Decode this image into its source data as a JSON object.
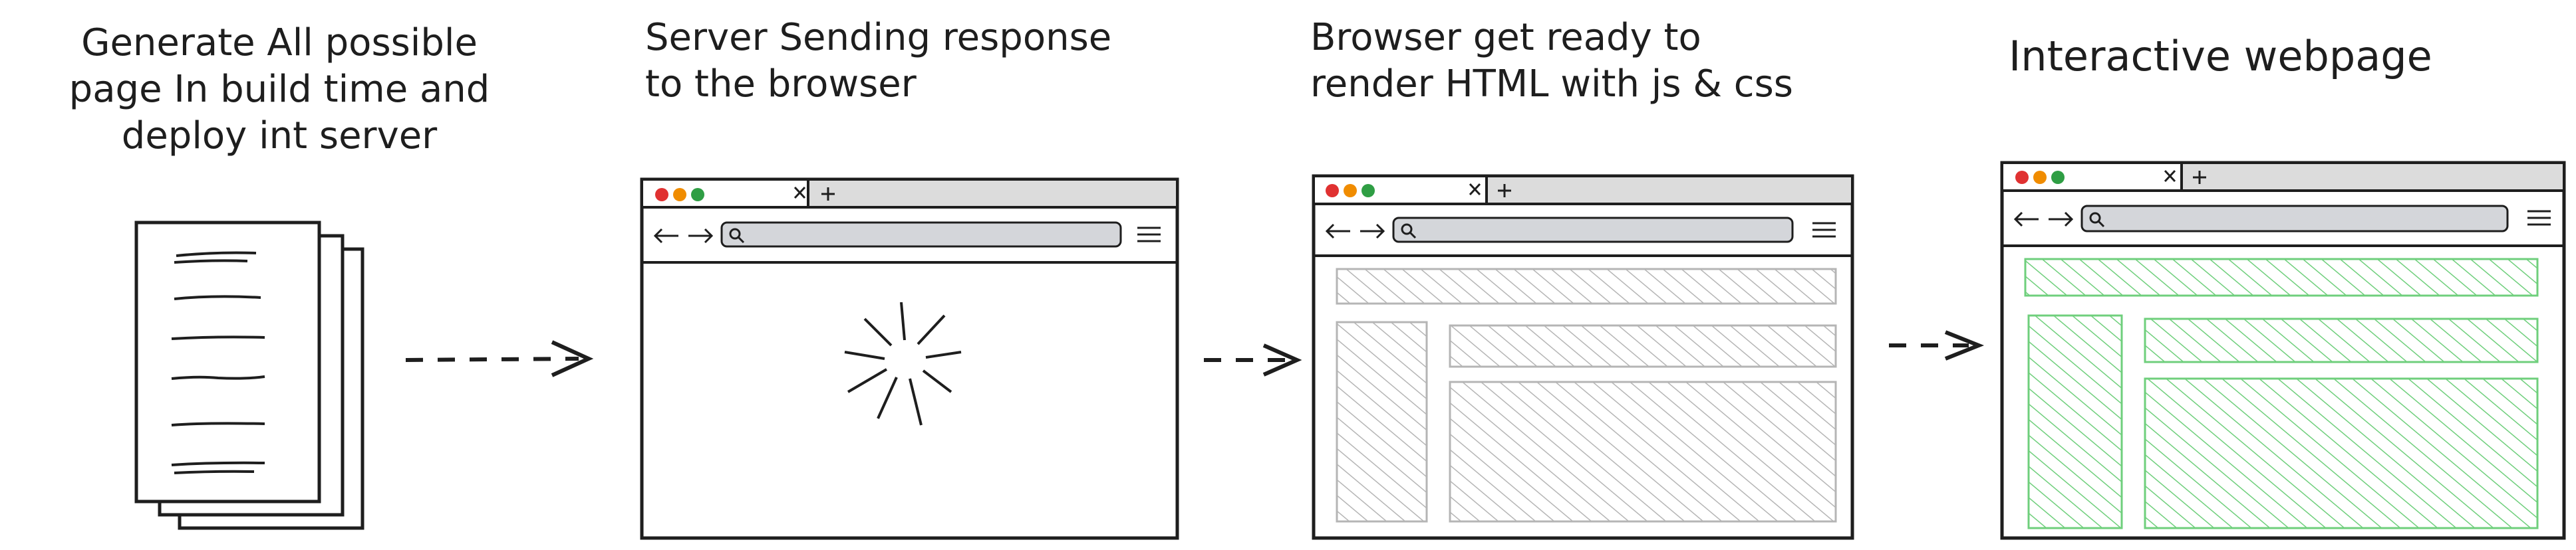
{
  "captions": {
    "step1": "Generate All possible\npage In build time and\ndeploy int server",
    "step2": "Server Sending response\nto the browser",
    "step3": "Browser get ready to\nrender HTML with js & css",
    "step4": "Interactive webpage"
  },
  "colors": {
    "ink": "#1e1e1e",
    "tab_bar": "#dcdcdc",
    "address_bar": "#d4d6da",
    "skeleton_hatch": "#b5b5b5",
    "interactive_hatch": "#6fcf7c",
    "dot_red": "#e03131",
    "dot_orange": "#f08c00",
    "dot_green": "#2f9e44"
  },
  "icons": [
    "document-stack-icon",
    "arrow-right-icon",
    "loading-spinner-icon",
    "back-arrow-icon",
    "forward-arrow-icon",
    "search-icon",
    "hamburger-menu-icon",
    "close-tab-icon",
    "new-tab-icon"
  ]
}
